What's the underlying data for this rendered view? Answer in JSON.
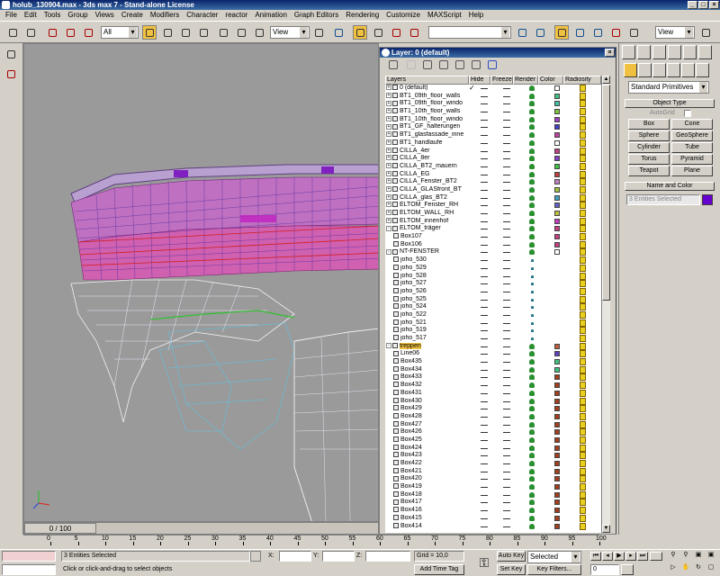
{
  "window": {
    "title": "holub_130904.max - 3ds max 7 - Stand-alone License",
    "min": "_",
    "max": "□",
    "close": "×"
  },
  "menu": [
    "File",
    "Edit",
    "Tools",
    "Group",
    "Views",
    "Create",
    "Modifiers",
    "Character",
    "reactor",
    "Animation",
    "Graph Editors",
    "Rendering",
    "Customize",
    "MAXScript",
    "Help"
  ],
  "toolbar": {
    "selection_filter": "All",
    "ref_coord": "View",
    "named_sel": "",
    "view_combo": "View"
  },
  "layer_dialog": {
    "title": "Layer: 0 (default)",
    "columns": [
      "Layers",
      "Hide",
      "Freeze",
      "Render",
      "Color",
      "Radiosity"
    ],
    "rows": [
      {
        "name": "0 (default)",
        "type": "layer",
        "exp": "+",
        "current": "✓",
        "color": "#ffffff"
      },
      {
        "name": "BT1_09th_floor_walls",
        "type": "layer",
        "exp": "+",
        "color": "#40c080"
      },
      {
        "name": "BT1_09th_floor_windo",
        "type": "layer",
        "exp": "+",
        "color": "#40c0a0"
      },
      {
        "name": "BT1_10th_floor_walls",
        "type": "layer",
        "exp": "+",
        "color": "#80c040"
      },
      {
        "name": "BT1_10th_floor_windo",
        "type": "layer",
        "exp": "+",
        "color": "#a040c0"
      },
      {
        "name": "BT1_GF_halterungen",
        "type": "layer",
        "exp": "+",
        "color": "#4040c0"
      },
      {
        "name": "BT1_glasfassade_inne",
        "type": "layer",
        "exp": "+",
        "color": "#c040a0"
      },
      {
        "name": "BT1_handlaufe",
        "type": "layer",
        "exp": "+",
        "color": "#ffffff"
      },
      {
        "name": "CILLA_4er",
        "type": "layer",
        "exp": "+",
        "color": "#c04080"
      },
      {
        "name": "CILLA_8er",
        "type": "layer",
        "exp": "+",
        "color": "#8040c0"
      },
      {
        "name": "CILLA_BT2_mauern",
        "type": "layer",
        "exp": "+",
        "color": "#40c040"
      },
      {
        "name": "CILLA_EG",
        "type": "layer",
        "exp": "+",
        "color": "#c04040"
      },
      {
        "name": "CILLA_Fenster_BT2",
        "type": "layer",
        "exp": "+",
        "color": "#c080c0"
      },
      {
        "name": "CILLA_GLASfront_BT",
        "type": "layer",
        "exp": "+",
        "color": "#a0c040"
      },
      {
        "name": "CILLA_glas_BT2",
        "type": "layer",
        "exp": "+",
        "color": "#40a0c0"
      },
      {
        "name": "ELTOM_Fenster_RH",
        "type": "layer",
        "exp": "+",
        "color": "#6060c0"
      },
      {
        "name": "ELTOM_WALL_RH",
        "type": "layer",
        "exp": "+",
        "color": "#c0c040"
      },
      {
        "name": "ELTOM_innenhof",
        "type": "layer",
        "exp": "+",
        "color": "#c040c0"
      },
      {
        "name": "ELTOM_träger",
        "type": "layer",
        "exp": "-",
        "color": "#c04080"
      },
      {
        "name": "Box107",
        "type": "object",
        "color": "#c04080"
      },
      {
        "name": "Box106",
        "type": "object",
        "color": "#c04080"
      },
      {
        "name": "NT-FENSTER",
        "type": "layer",
        "exp": "-",
        "color": "#ffffff"
      },
      {
        "name": "joho_530",
        "type": "object",
        "small": true
      },
      {
        "name": "joho_529",
        "type": "object",
        "small": true
      },
      {
        "name": "joho_528",
        "type": "object",
        "small": true
      },
      {
        "name": "joho_527",
        "type": "object",
        "small": true
      },
      {
        "name": "joho_526",
        "type": "object",
        "small": true
      },
      {
        "name": "joho_525",
        "type": "object",
        "small": true
      },
      {
        "name": "joho_524",
        "type": "object",
        "small": true
      },
      {
        "name": "joho_522",
        "type": "object",
        "small": true
      },
      {
        "name": "joho_521",
        "type": "object",
        "small": true
      },
      {
        "name": "joho_519",
        "type": "object",
        "small": true
      },
      {
        "name": "joho_517",
        "type": "object",
        "small": true
      },
      {
        "name": "treppen",
        "type": "layer",
        "exp": "-",
        "selected": true,
        "color": "#c06040"
      },
      {
        "name": "Line06",
        "type": "object",
        "color": "#6040c0"
      },
      {
        "name": "Box435",
        "type": "object",
        "color": "#40c080"
      },
      {
        "name": "Box434",
        "type": "object",
        "color": "#40c080"
      },
      {
        "name": "Box433",
        "type": "object",
        "color": "#a04020"
      },
      {
        "name": "Box432",
        "type": "object",
        "color": "#a04020"
      },
      {
        "name": "Box431",
        "type": "object",
        "color": "#a04020"
      },
      {
        "name": "Box430",
        "type": "object",
        "color": "#a04020"
      },
      {
        "name": "Box429",
        "type": "object",
        "color": "#a04020"
      },
      {
        "name": "Box428",
        "type": "object",
        "color": "#a04020"
      },
      {
        "name": "Box427",
        "type": "object",
        "color": "#a04020"
      },
      {
        "name": "Box426",
        "type": "object",
        "color": "#a04020"
      },
      {
        "name": "Box425",
        "type": "object",
        "color": "#a04020"
      },
      {
        "name": "Box424",
        "type": "object",
        "color": "#a04020"
      },
      {
        "name": "Box423",
        "type": "object",
        "color": "#a04020"
      },
      {
        "name": "Box422",
        "type": "object",
        "color": "#a04020"
      },
      {
        "name": "Box421",
        "type": "object",
        "color": "#a04020"
      },
      {
        "name": "Box420",
        "type": "object",
        "color": "#a04020"
      },
      {
        "name": "Box419",
        "type": "object",
        "color": "#a04020"
      },
      {
        "name": "Box418",
        "type": "object",
        "color": "#a04020"
      },
      {
        "name": "Box417",
        "type": "object",
        "color": "#a04020"
      },
      {
        "name": "Box416",
        "type": "object",
        "color": "#a04020"
      },
      {
        "name": "Box415",
        "type": "object",
        "color": "#a04020"
      },
      {
        "name": "Box414",
        "type": "object",
        "color": "#a04020"
      }
    ]
  },
  "command_panel": {
    "category": "Standard Primitives",
    "object_type_header": "Object Type",
    "autogrid": "AutoGrid",
    "buttons": [
      "Box",
      "Cone",
      "Sphere",
      "GeoSphere",
      "Cylinder",
      "Tube",
      "Torus",
      "Pyramid",
      "Teapot",
      "Plane"
    ],
    "name_color_header": "Name and Color",
    "name_value": "3 Entities Selected",
    "swatch_color": "#6600cc"
  },
  "timeline": {
    "slider": "0 / 100",
    "ticks": [
      "0",
      "5",
      "10",
      "15",
      "20",
      "25",
      "30",
      "35",
      "40",
      "45",
      "50",
      "55",
      "60",
      "65",
      "70",
      "75",
      "80",
      "85",
      "90",
      "95",
      "100"
    ]
  },
  "status": {
    "selection": "3 Entities Selected",
    "prompt": "Click or click-and-drag to select objects",
    "x_label": "X:",
    "y_label": "Y:",
    "z_label": "Z:",
    "x": "",
    "y": "",
    "z": "",
    "grid": "Grid = 10,0",
    "add_time_tag": "Add Time Tag",
    "auto_key": "Auto Key",
    "set_key": "Set Key",
    "selected_combo": "Selected",
    "key_filters": "Key Filters...",
    "frame": "0"
  },
  "accent": "#f0c040"
}
